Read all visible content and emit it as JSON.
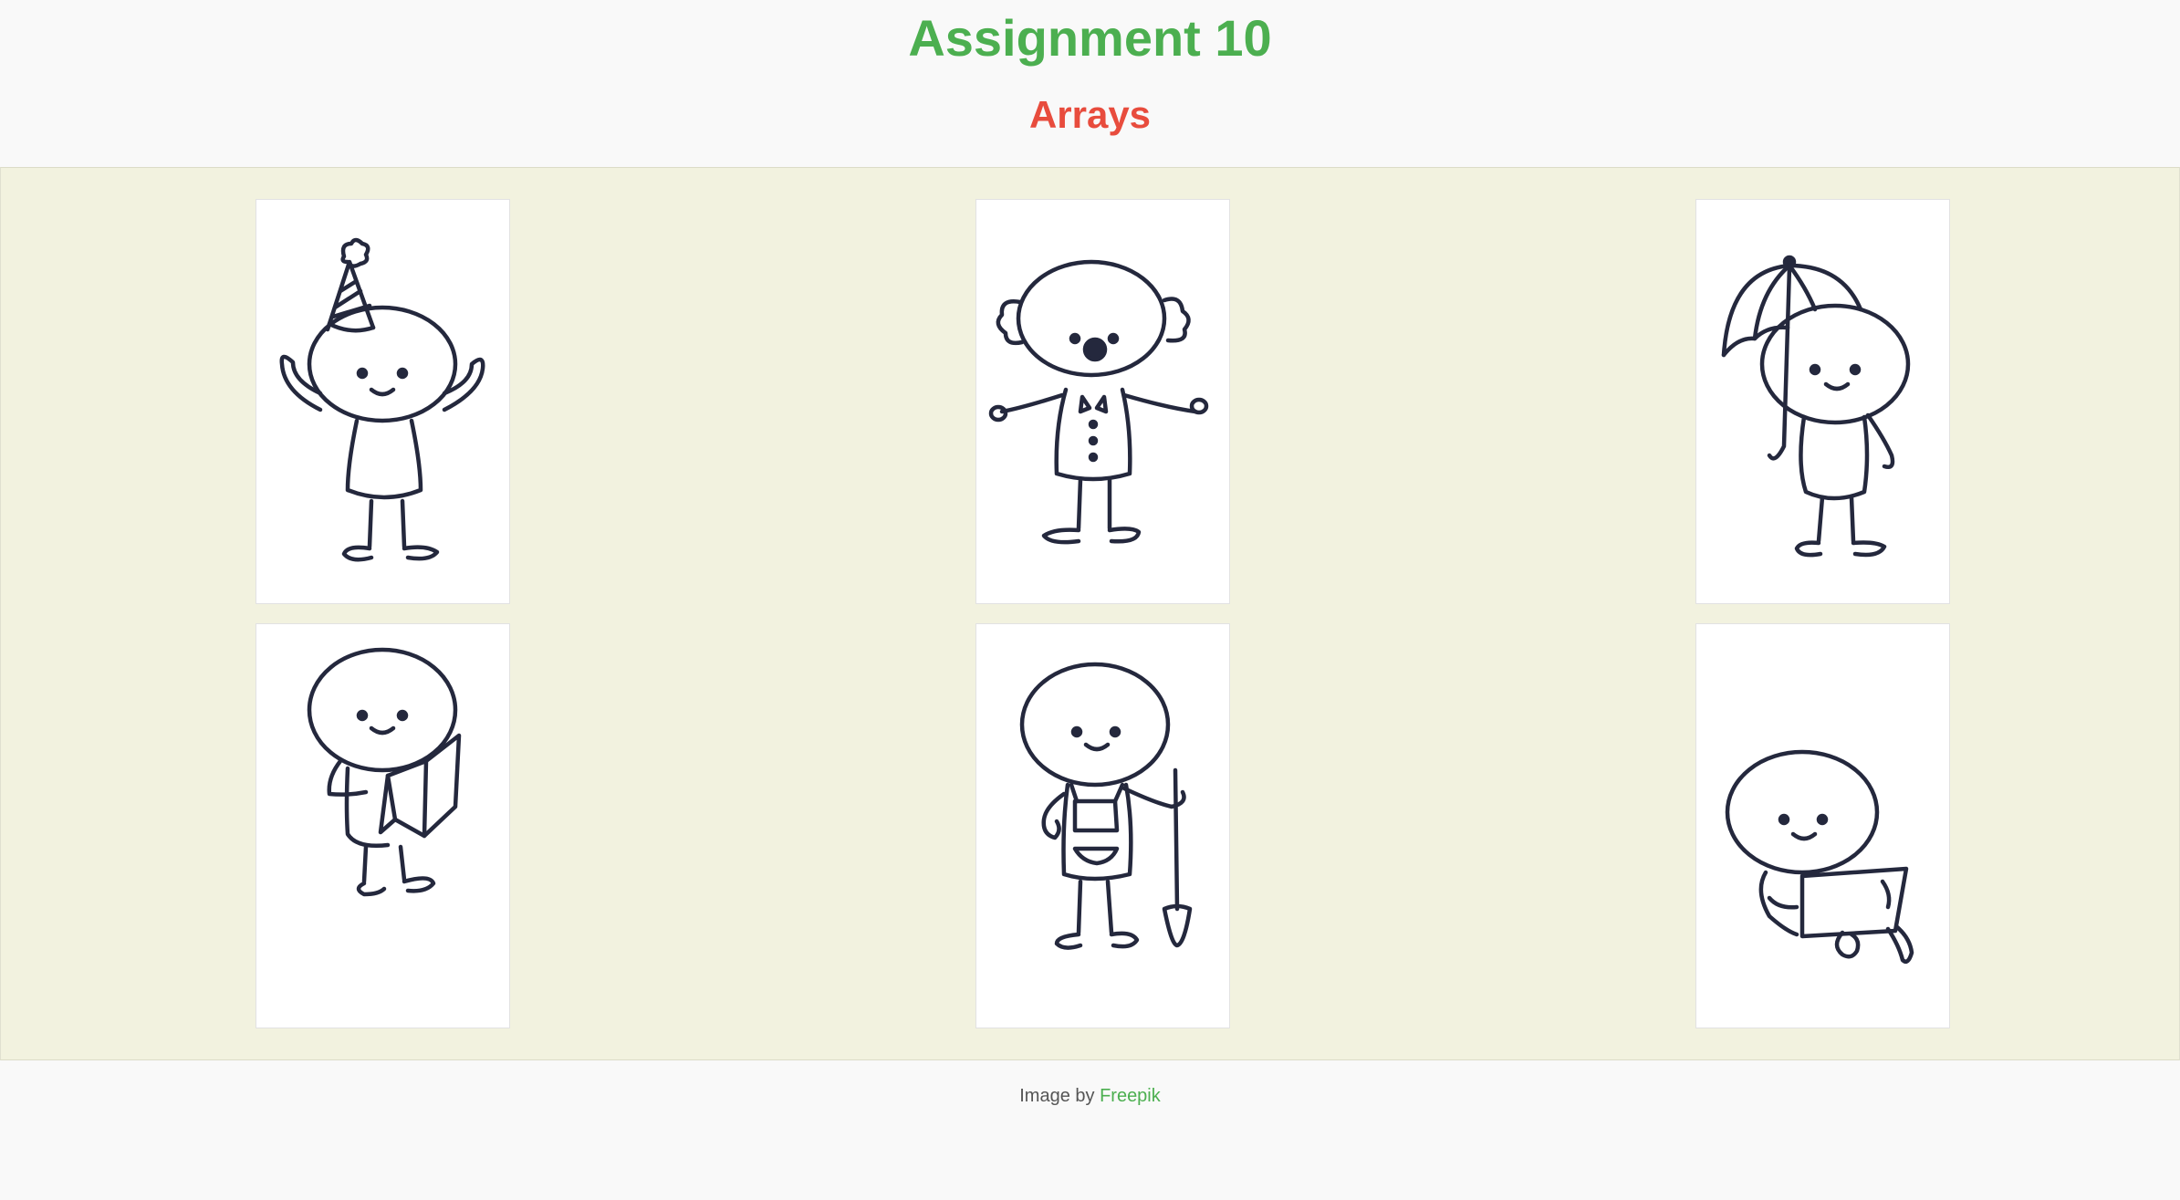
{
  "header": {
    "title": "Assignment 10",
    "subtitle": "Arrays"
  },
  "gallery": {
    "images": [
      {
        "icon": "stick-figure-party-hat-icon"
      },
      {
        "icon": "stick-figure-clown-icon"
      },
      {
        "icon": "stick-figure-umbrella-icon"
      },
      {
        "icon": "stick-figure-reading-book-icon"
      },
      {
        "icon": "stick-figure-gardener-shovel-icon"
      },
      {
        "icon": "stick-figure-laptop-icon"
      }
    ]
  },
  "footer": {
    "credit_prefix": "Image by",
    "credit_link": "Freepik"
  },
  "colors": {
    "title": "#4caf50",
    "subtitle": "#e84c3d",
    "gallery_background": "#f2f2df",
    "ink": "#24283d"
  }
}
